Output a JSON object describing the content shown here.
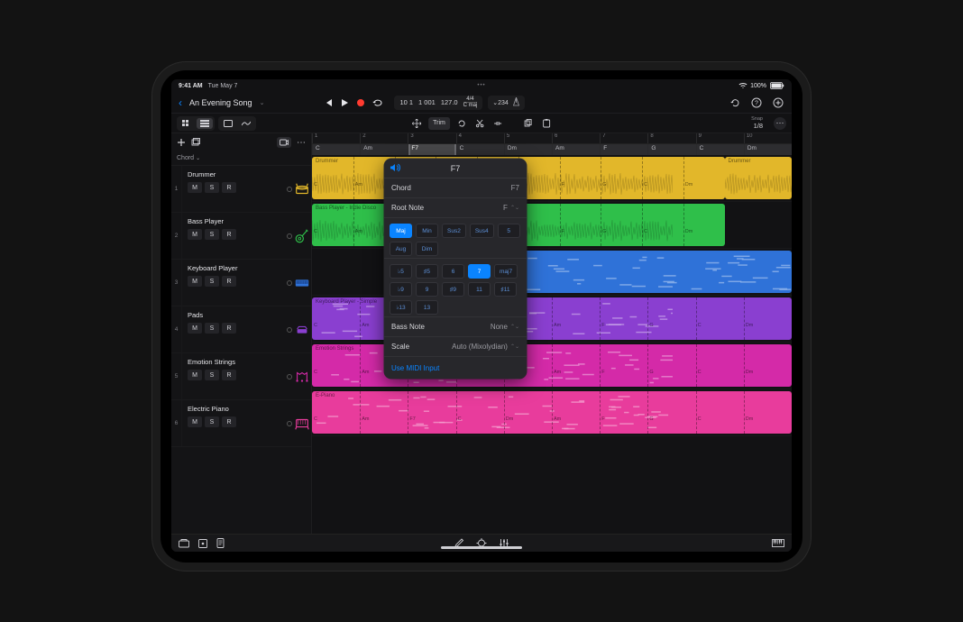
{
  "statusbar": {
    "time": "9:41 AM",
    "date": "Tue May 7",
    "battery": "100%"
  },
  "header": {
    "song_title": "An Evening Song",
    "lcd": {
      "bars": "10 1",
      "beat_sub": "1 001",
      "tempo": "127.0",
      "sig_top": "4/4",
      "sig_bot": "C maj"
    },
    "lcd_extra": "⌄234"
  },
  "subbar": {
    "trim_label": "Trim",
    "snap_label": "Snap",
    "snap_value": "1/8"
  },
  "sidebar": {
    "chord_label": "Chord",
    "msr": {
      "m": "M",
      "s": "S",
      "r": "R"
    },
    "tracks": [
      {
        "num": "1",
        "name": "Drummer",
        "color": "#e2b72a"
      },
      {
        "num": "2",
        "name": "Bass Player",
        "color": "#2fbf4a"
      },
      {
        "num": "3",
        "name": "Keyboard Player",
        "color": "#2f72d8"
      },
      {
        "num": "4",
        "name": "Pads",
        "color": "#8a3fd0"
      },
      {
        "num": "5",
        "name": "Emotion Strings",
        "color": "#d42aa8"
      },
      {
        "num": "6",
        "name": "Electric Piano",
        "color": "#e83c9c"
      }
    ]
  },
  "timeline": {
    "ruler": [
      "1",
      "2",
      "3",
      "4",
      "5",
      "6",
      "7",
      "8",
      "9",
      "10"
    ],
    "chords": [
      "C",
      "Am",
      "F7",
      "C",
      "Dm",
      "Am",
      "F",
      "G",
      "C",
      "Dm"
    ],
    "selected_chord_index": 2,
    "region_labels": {
      "drummer": "Drummer",
      "drummer2": "Drummer",
      "bass": "Bass Player - Indie Disco",
      "keys": "Keyboard Player - Simple",
      "strings": "Emotion Strings",
      "epiano": "E-Piano"
    },
    "region_chord_labels": [
      "C",
      "Am",
      "F7",
      "C",
      "Dm",
      "Am",
      "F",
      "G",
      "C",
      "Dm"
    ]
  },
  "popover": {
    "title": "F7",
    "rows": {
      "chord_label": "Chord",
      "chord_value": "F7",
      "root_label": "Root Note",
      "root_value": "F",
      "bass_label": "Bass Note",
      "bass_value": "None",
      "scale_label": "Scale",
      "scale_value": "Auto (Mixolydian)"
    },
    "quality": {
      "items": [
        "Maj",
        "Min",
        "Sus2",
        "Sus4",
        "5",
        "Aug",
        "Dim"
      ],
      "selected": 0
    },
    "ext_row1": {
      "items": [
        "♭5",
        "♯5",
        "6",
        "7",
        "maj7"
      ],
      "selected": 3
    },
    "ext_row2": {
      "items": [
        "♭9",
        "9",
        "♯9",
        "11",
        "♯11"
      ],
      "selected": -1
    },
    "ext_row3": {
      "items": [
        "♭13",
        "13"
      ],
      "selected": -1
    },
    "midi_link": "Use MIDI Input"
  }
}
